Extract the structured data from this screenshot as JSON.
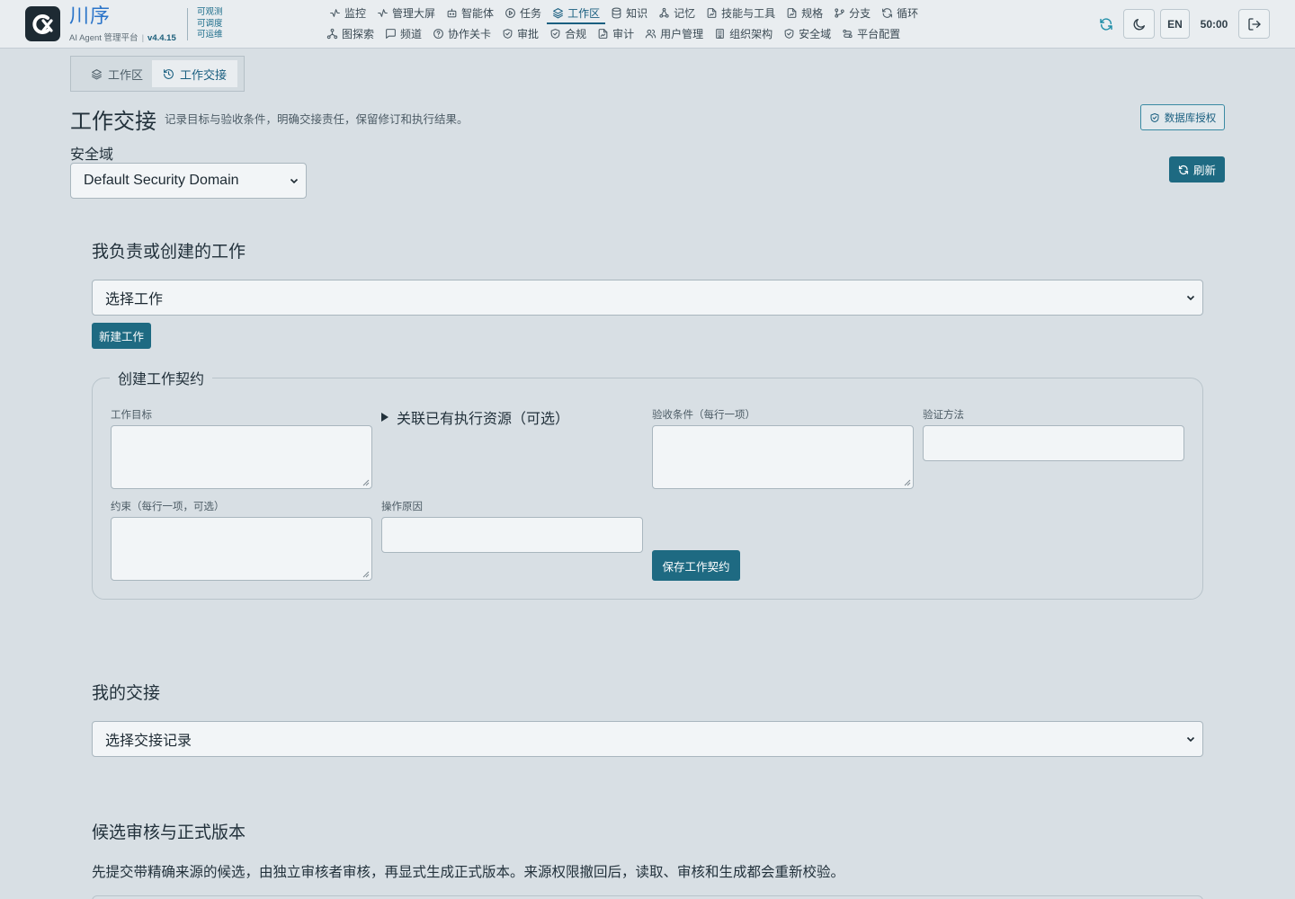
{
  "brand": {
    "name": "川序",
    "subtitle": "AI Agent 管理平台",
    "separator": "|",
    "version": "v4.4.15",
    "traits": [
      "可观测",
      "可调度",
      "可运维"
    ]
  },
  "nav": {
    "row1": [
      {
        "label": "监控",
        "icon": "activity-icon"
      },
      {
        "label": "管理大屏",
        "icon": "activity-icon"
      },
      {
        "label": "智能体",
        "icon": "bot-icon"
      },
      {
        "label": "任务",
        "icon": "play-circle-icon"
      },
      {
        "label": "工作区",
        "icon": "layers-icon",
        "active": true
      },
      {
        "label": "知识",
        "icon": "database-icon"
      },
      {
        "label": "记忆",
        "icon": "nodes-icon"
      },
      {
        "label": "技能与工具",
        "icon": "file-sign-icon"
      },
      {
        "label": "规格",
        "icon": "file-sign-icon"
      },
      {
        "label": "分支",
        "icon": "branch-icon"
      },
      {
        "label": "循环",
        "icon": "loop-icon"
      }
    ],
    "row2": [
      {
        "label": "图探索",
        "icon": "graph-icon"
      },
      {
        "label": "频道",
        "icon": "chat-icon"
      },
      {
        "label": "协作关卡",
        "icon": "help-circle-icon"
      },
      {
        "label": "审批",
        "icon": "shield-check-icon"
      },
      {
        "label": "合规",
        "icon": "shield-check-icon"
      },
      {
        "label": "审计",
        "icon": "file-sign-icon"
      },
      {
        "label": "用户管理",
        "icon": "users-icon"
      },
      {
        "label": "组织架构",
        "icon": "building-icon"
      },
      {
        "label": "安全域",
        "icon": "shield-check-icon"
      },
      {
        "label": "平台配置",
        "icon": "settings-route-icon"
      }
    ]
  },
  "header": {
    "lang": "EN",
    "timer": "50:00"
  },
  "tabs": [
    {
      "label": "工作区",
      "icon": "layers-icon"
    },
    {
      "label": "工作交接",
      "icon": "history-icon",
      "active": true
    }
  ],
  "page": {
    "title": "工作交接",
    "subtitle": "记录目标与验收条件，明确交接责任，保留修订和执行结果。",
    "db_auth_label": "数据库授权",
    "refresh_label": "刷新",
    "domain_label": "安全域",
    "domain_value": "Default Security Domain"
  },
  "work_section": {
    "title": "我负责或创建的工作",
    "select_value": "选择工作",
    "new_button": "新建工作"
  },
  "contract_form": {
    "legend": "创建工作契约",
    "goal_label": "工作目标",
    "link_resources": "关联已有执行资源（可选）",
    "acceptance_label": "验收条件（每行一项）",
    "verify_label": "验证方法",
    "constraints_label": "约束（每行一项，可选）",
    "reason_label": "操作原因",
    "save_button": "保存工作契约"
  },
  "handoff_section": {
    "title": "我的交接",
    "select_value": "选择交接记录"
  },
  "review_section": {
    "title": "候选审核与正式版本",
    "description": "先提交带精确来源的候选，由独立审核者审核，再显式生成正式版本。来源权限撤回后，读取、审核和生成都会重新校验。"
  },
  "colors": {
    "accent": "#1e6a82",
    "brand_blue": "#2a74c9",
    "background": "#d8dfe4"
  }
}
